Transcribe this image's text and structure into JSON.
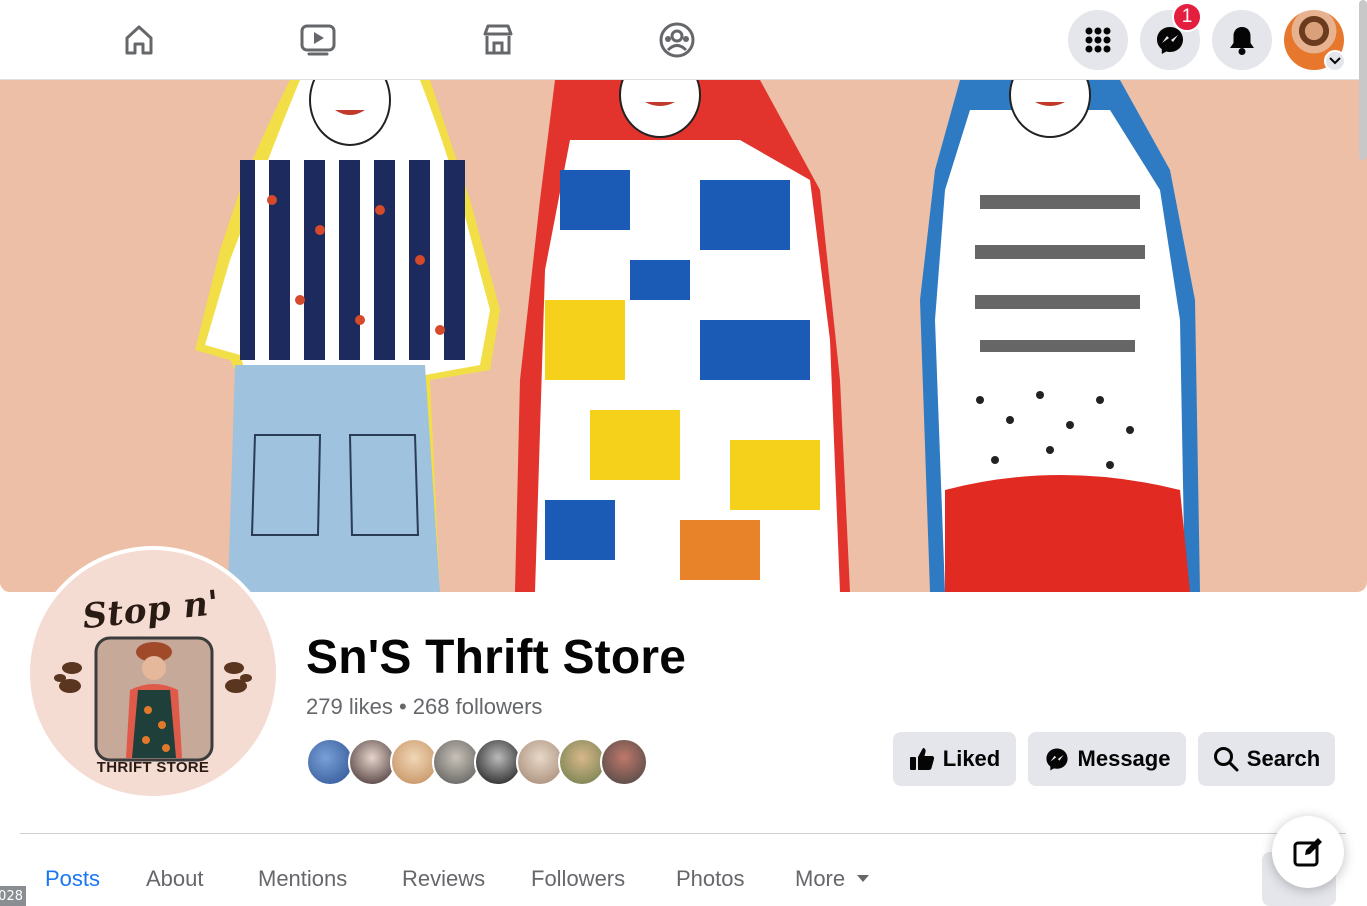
{
  "nav": {
    "home_icon": "home-icon",
    "watch_icon": "watch-icon",
    "marketplace_icon": "marketplace-icon",
    "groups_icon": "groups-icon"
  },
  "header_right": {
    "menu_icon": "grid-menu-icon",
    "messenger_icon": "messenger-icon",
    "messenger_badge": "1",
    "notifications_icon": "bell-icon"
  },
  "profile": {
    "logo_script": "Stop n' Shop",
    "logo_subtitle": "THRIFT STORE",
    "name": "Sn'S Thrift Store",
    "likes": "279 likes",
    "separator": "•",
    "followers": "268 followers"
  },
  "actions": {
    "liked": "Liked",
    "message": "Message",
    "search": "Search"
  },
  "tabs": [
    {
      "label": "Posts",
      "active": true
    },
    {
      "label": "About"
    },
    {
      "label": "Mentions"
    },
    {
      "label": "Reviews"
    },
    {
      "label": "Followers"
    },
    {
      "label": "Photos"
    },
    {
      "label": "More"
    }
  ],
  "corner_label": "028",
  "colors": {
    "accent": "#1877f2",
    "badge": "#e41e3f",
    "button_bg": "#e4e6eb",
    "cover_bg": "#ecbfa6"
  }
}
